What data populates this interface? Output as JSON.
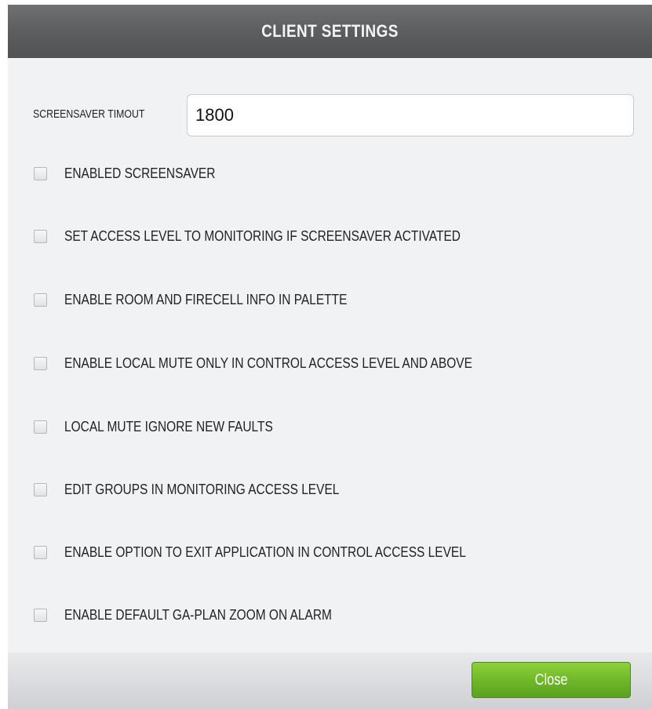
{
  "dialog": {
    "title": "CLIENT SETTINGS"
  },
  "screensaver": {
    "timeout_label": "SCREENSAVER TIMOUT",
    "timeout_value": "1800"
  },
  "options": [
    {
      "label": "ENABLED SCREENSAVER",
      "checked": false
    },
    {
      "label": "SET ACCESS LEVEL TO MONITORING IF SCREENSAVER ACTIVATED",
      "checked": false
    },
    {
      "label": "ENABLE ROOM AND FIRECELL INFO IN PALETTE",
      "checked": false
    },
    {
      "label": "ENABLE LOCAL MUTE ONLY IN CONTROL ACCESS LEVEL AND ABOVE",
      "checked": false
    },
    {
      "label": "LOCAL MUTE IGNORE NEW FAULTS",
      "checked": false
    },
    {
      "label": "EDIT GROUPS IN MONITORING ACCESS LEVEL",
      "checked": false
    },
    {
      "label": "ENABLE OPTION TO EXIT APPLICATION IN CONTROL ACCESS LEVEL",
      "checked": false
    },
    {
      "label": "ENABLE DEFAULT GA-PLAN ZOOM ON ALARM",
      "checked": false
    }
  ],
  "footer": {
    "close_label": "Close"
  },
  "colors": {
    "header": "#5c5e60",
    "close_button": "#6fb82a",
    "body_background": "#f1f2f4"
  }
}
